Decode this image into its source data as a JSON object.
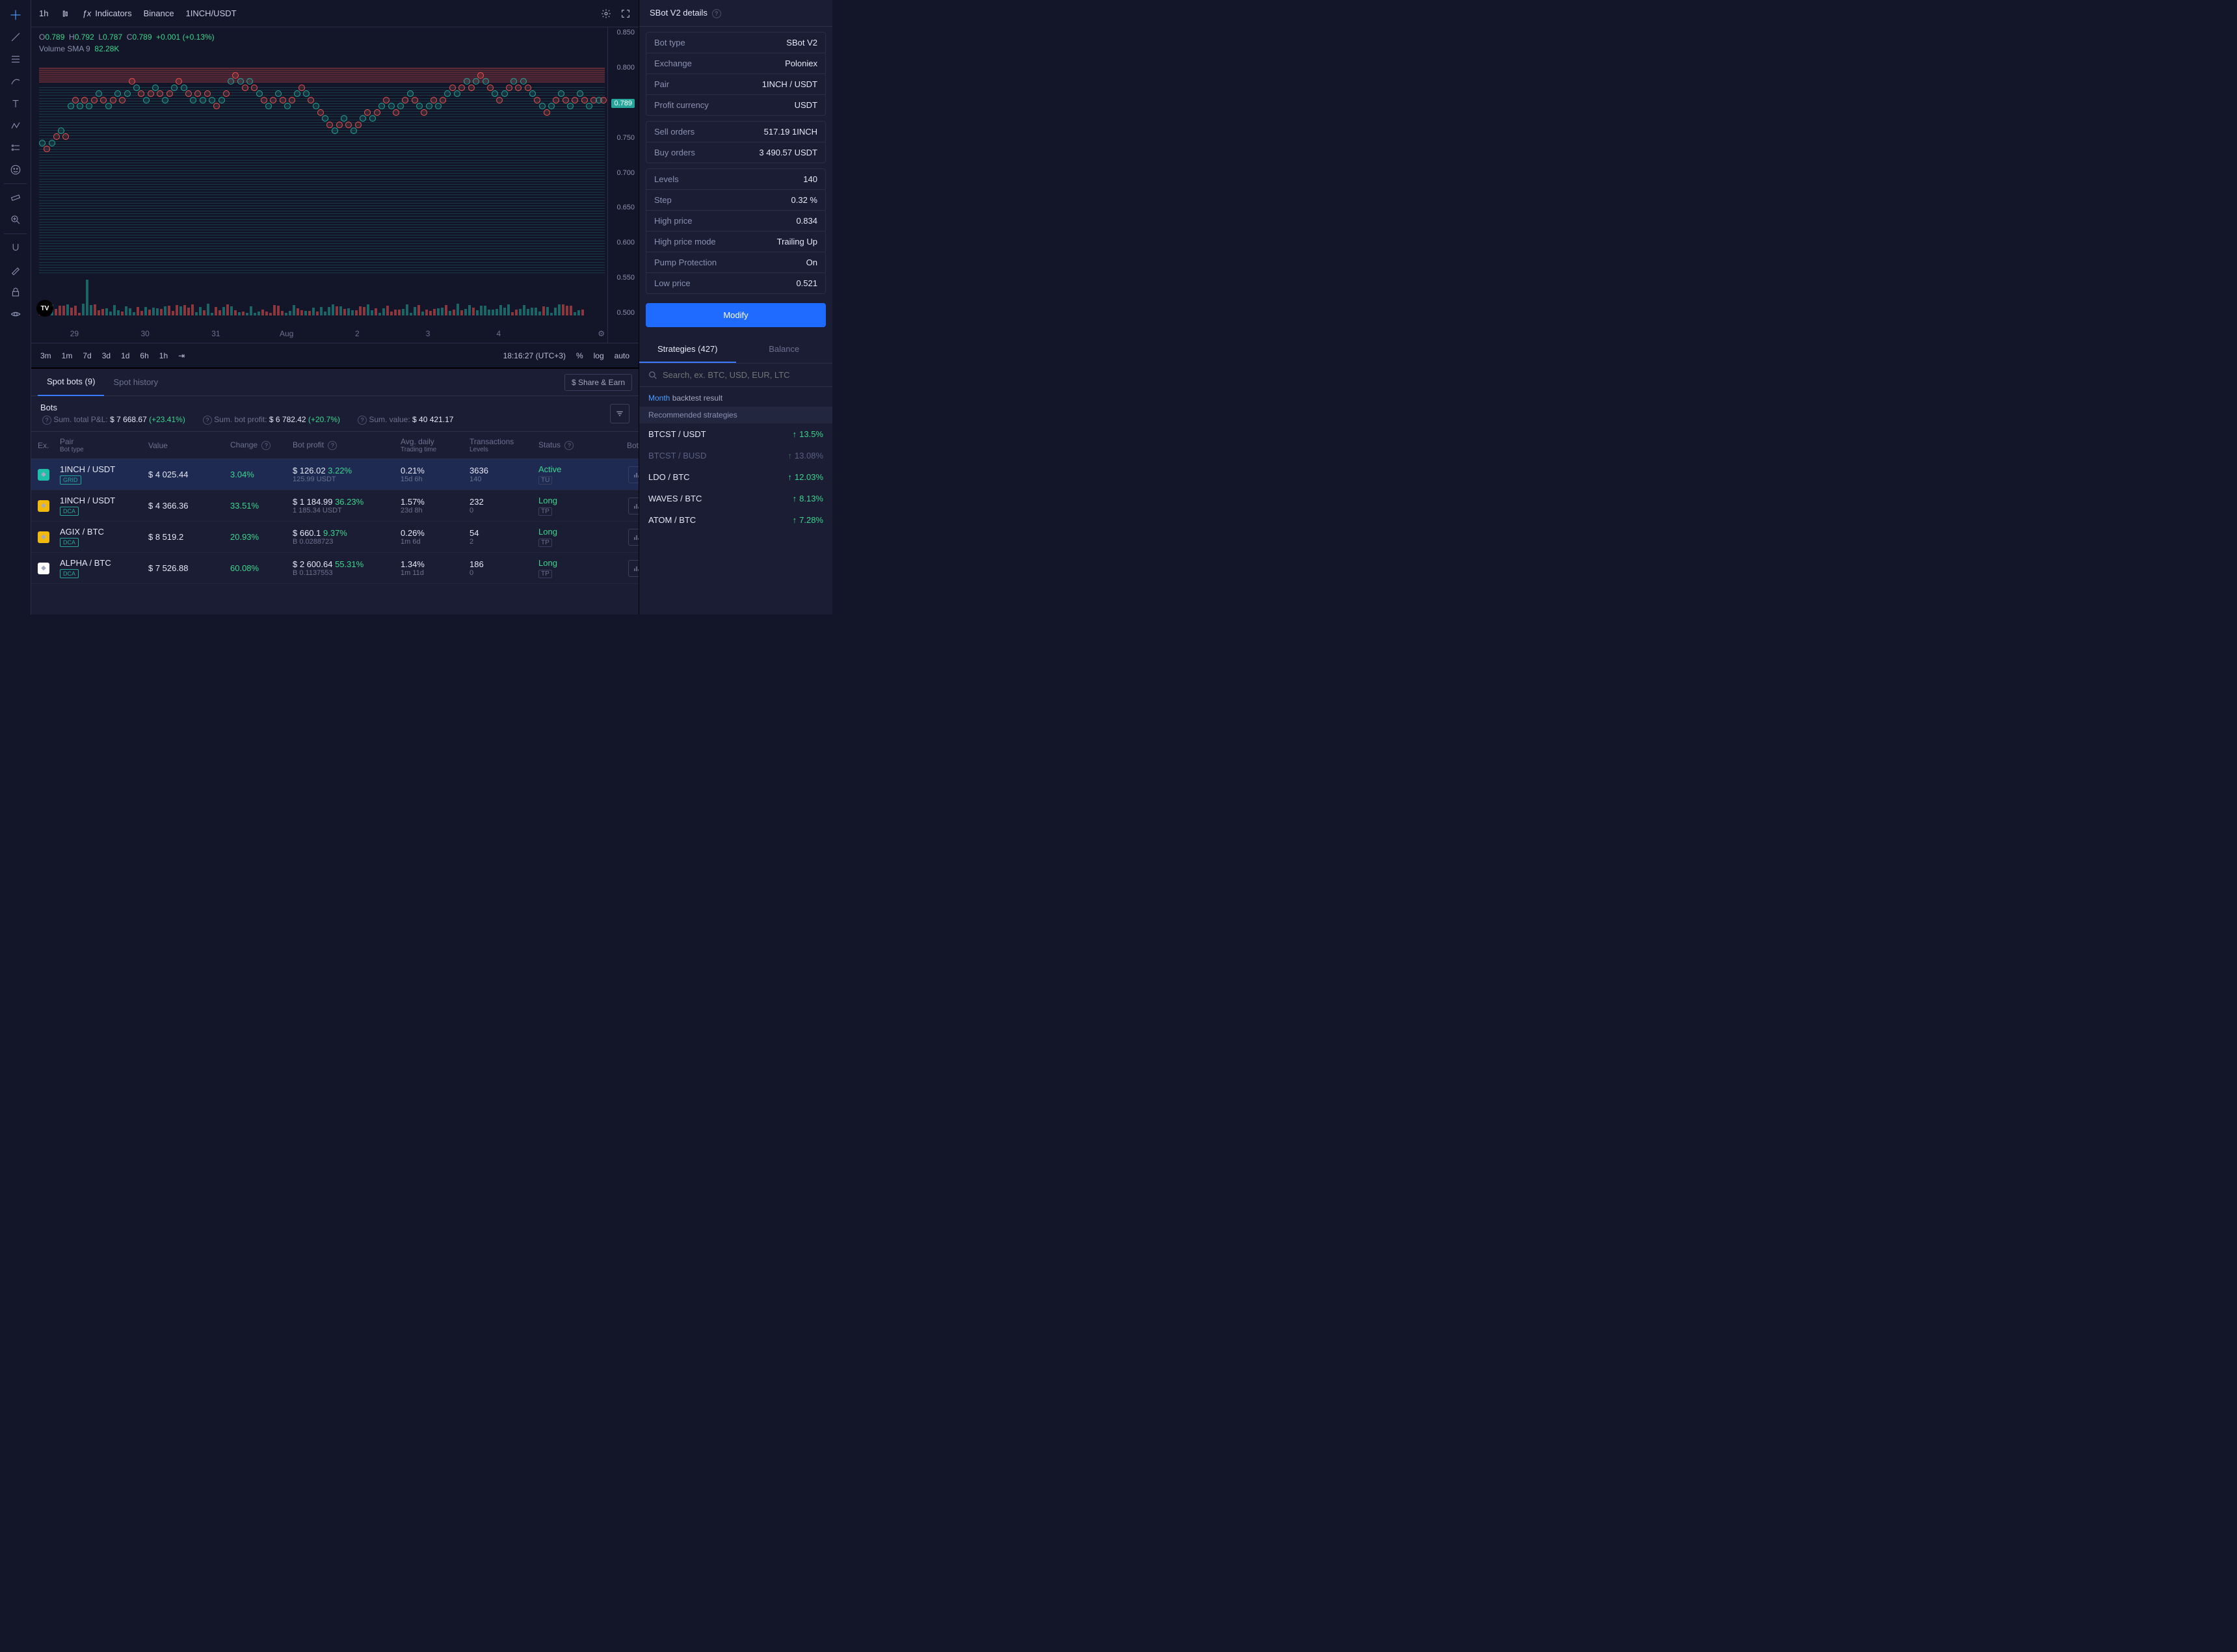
{
  "chart": {
    "top": {
      "timeframe": "1h",
      "indicators": "Indicators",
      "exchange": "Binance",
      "pair": "1INCH/USDT"
    },
    "ohlc": {
      "o": "0.789",
      "h": "0.792",
      "l": "0.787",
      "c": "0.789",
      "chg": "+0.001",
      "pct": "(+0.13%)"
    },
    "volume_label": "Volume SMA 9",
    "volume_value": "82.28K",
    "yaxis": [
      "0.850",
      "0.800",
      "0.750",
      "0.700",
      "0.650",
      "0.600",
      "0.550",
      "0.500"
    ],
    "price_tag": "0.789",
    "xaxis": [
      "29",
      "30",
      "31",
      "Aug",
      "2",
      "3",
      "4"
    ],
    "timeframes": [
      "3m",
      "1m",
      "7d",
      "3d",
      "1d",
      "6h",
      "1h"
    ],
    "clock": "18:16:27 (UTC+3)",
    "axis_opts": [
      "%",
      "log",
      "auto"
    ]
  },
  "bots_tabs": {
    "active": "Spot bots (9)",
    "history": "Spot history",
    "share": "$ Share & Earn"
  },
  "bots_summary": {
    "title": "Bots",
    "sum_pl_label": "Sum. total P&L:",
    "sum_pl": "$ 7 668.67",
    "sum_pl_pct": "(+23.41%)",
    "sum_profit_label": "Sum. bot profit:",
    "sum_profit": "$ 6 782.42",
    "sum_profit_pct": "(+20.7%)",
    "sum_value_label": "Sum. value:",
    "sum_value": "$ 40 421.17"
  },
  "bots_cols": {
    "ex": "Ex.",
    "pair": "Pair",
    "pair_sub": "Bot type",
    "value": "Value",
    "change": "Change",
    "profit": "Bot profit",
    "avg": "Avg. daily",
    "avg_sub": "Trading time",
    "tx": "Transactions",
    "tx_sub": "Levels",
    "status": "Status",
    "options": "Bot options"
  },
  "bots": [
    {
      "ex_color": "#1fbfa7",
      "pair": "1INCH / USDT",
      "type": "GRID",
      "value": "$ 4 025.44",
      "change": "3.04%",
      "profit_amt": "$ 126.02",
      "profit_pct": "3.22%",
      "profit_sub": "125.99 USDT",
      "avg": "0.21%",
      "avg_sub": "15d 6h",
      "tx": "3636",
      "tx_sub": "140",
      "status": "Active",
      "status_sub": "TU",
      "selected": true
    },
    {
      "ex_color": "#f0b90b",
      "pair": "1INCH / USDT",
      "type": "DCA",
      "value": "$ 4 366.36",
      "change": "33.51%",
      "profit_amt": "$ 1 184.99",
      "profit_pct": "36.23%",
      "profit_sub": "1 185.34 USDT",
      "avg": "1.57%",
      "avg_sub": "23d 8h",
      "tx": "232",
      "tx_sub": "0",
      "status": "Long",
      "status_sub": "TP",
      "selected": false
    },
    {
      "ex_color": "#f0b90b",
      "pair": "AGIX / BTC",
      "type": "DCA",
      "value": "$ 8 519.2",
      "change": "20.93%",
      "profit_amt": "$ 660.1",
      "profit_pct": "9.37%",
      "profit_sub": "B 0.0288723",
      "avg": "0.26%",
      "avg_sub": "1m 6d",
      "tx": "54",
      "tx_sub": "2",
      "status": "Long",
      "status_sub": "TP",
      "selected": false
    },
    {
      "ex_color": "#ffffff",
      "pair": "ALPHA / BTC",
      "type": "DCA",
      "value": "$ 7 526.88",
      "change": "60.08%",
      "profit_amt": "$ 2 600.64",
      "profit_pct": "55.31%",
      "profit_sub": "B 0.1137553",
      "avg": "1.34%",
      "avg_sub": "1m 11d",
      "tx": "186",
      "tx_sub": "0",
      "status": "Long",
      "status_sub": "TP",
      "selected": false
    }
  ],
  "details": {
    "title": "SBot V2 details",
    "blocks": [
      [
        {
          "k": "Bot type",
          "v": "SBot V2"
        },
        {
          "k": "Exchange",
          "v": "Poloniex"
        },
        {
          "k": "Pair",
          "v": "1INCH / USDT"
        },
        {
          "k": "Profit currency",
          "v": "USDT"
        }
      ],
      [
        {
          "k": "Sell orders",
          "v": "517.19 1INCH"
        },
        {
          "k": "Buy orders",
          "v": "3 490.57 USDT"
        }
      ],
      [
        {
          "k": "Levels",
          "v": "140"
        },
        {
          "k": "Step",
          "v": "0.32 %"
        },
        {
          "k": "High price",
          "v": "0.834"
        },
        {
          "k": "High price mode",
          "v": "Trailing Up"
        },
        {
          "k": "Pump Protection",
          "v": "On"
        },
        {
          "k": "Low price",
          "v": "0.521"
        }
      ]
    ],
    "modify": "Modify"
  },
  "strategies": {
    "tab_strategies": "Strategies (427)",
    "tab_balance": "Balance",
    "search_placeholder": "Search, ex. BTC, USD, EUR, LTC",
    "period": "Month",
    "backtest": "backtest result",
    "rec_header": "Recommended strategies",
    "items": [
      {
        "name": "BTCST / USDT",
        "pct": "13.5%",
        "dim": false
      },
      {
        "name": "BTCST / BUSD",
        "pct": "13.08%",
        "dim": true
      },
      {
        "name": "LDO / BTC",
        "pct": "12.03%",
        "dim": false
      },
      {
        "name": "WAVES / BTC",
        "pct": "8.13%",
        "dim": false
      },
      {
        "name": "ATOM / BTC",
        "pct": "7.28%",
        "dim": false
      }
    ]
  },
  "chart_data": {
    "type": "candlestick-grid",
    "pair": "1INCH/USDT",
    "timeframe": "1h",
    "y_range": [
      0.5,
      0.85
    ],
    "current_price": 0.789,
    "grid_sell_zone": [
      0.79,
      0.834
    ],
    "grid_buy_zone": [
      0.521,
      0.789
    ],
    "x_ticks": [
      "29",
      "30",
      "31",
      "Aug",
      "2",
      "3",
      "4"
    ],
    "note": "Dense hourly candles with grid buy/sell markers; values approximate from axis."
  }
}
